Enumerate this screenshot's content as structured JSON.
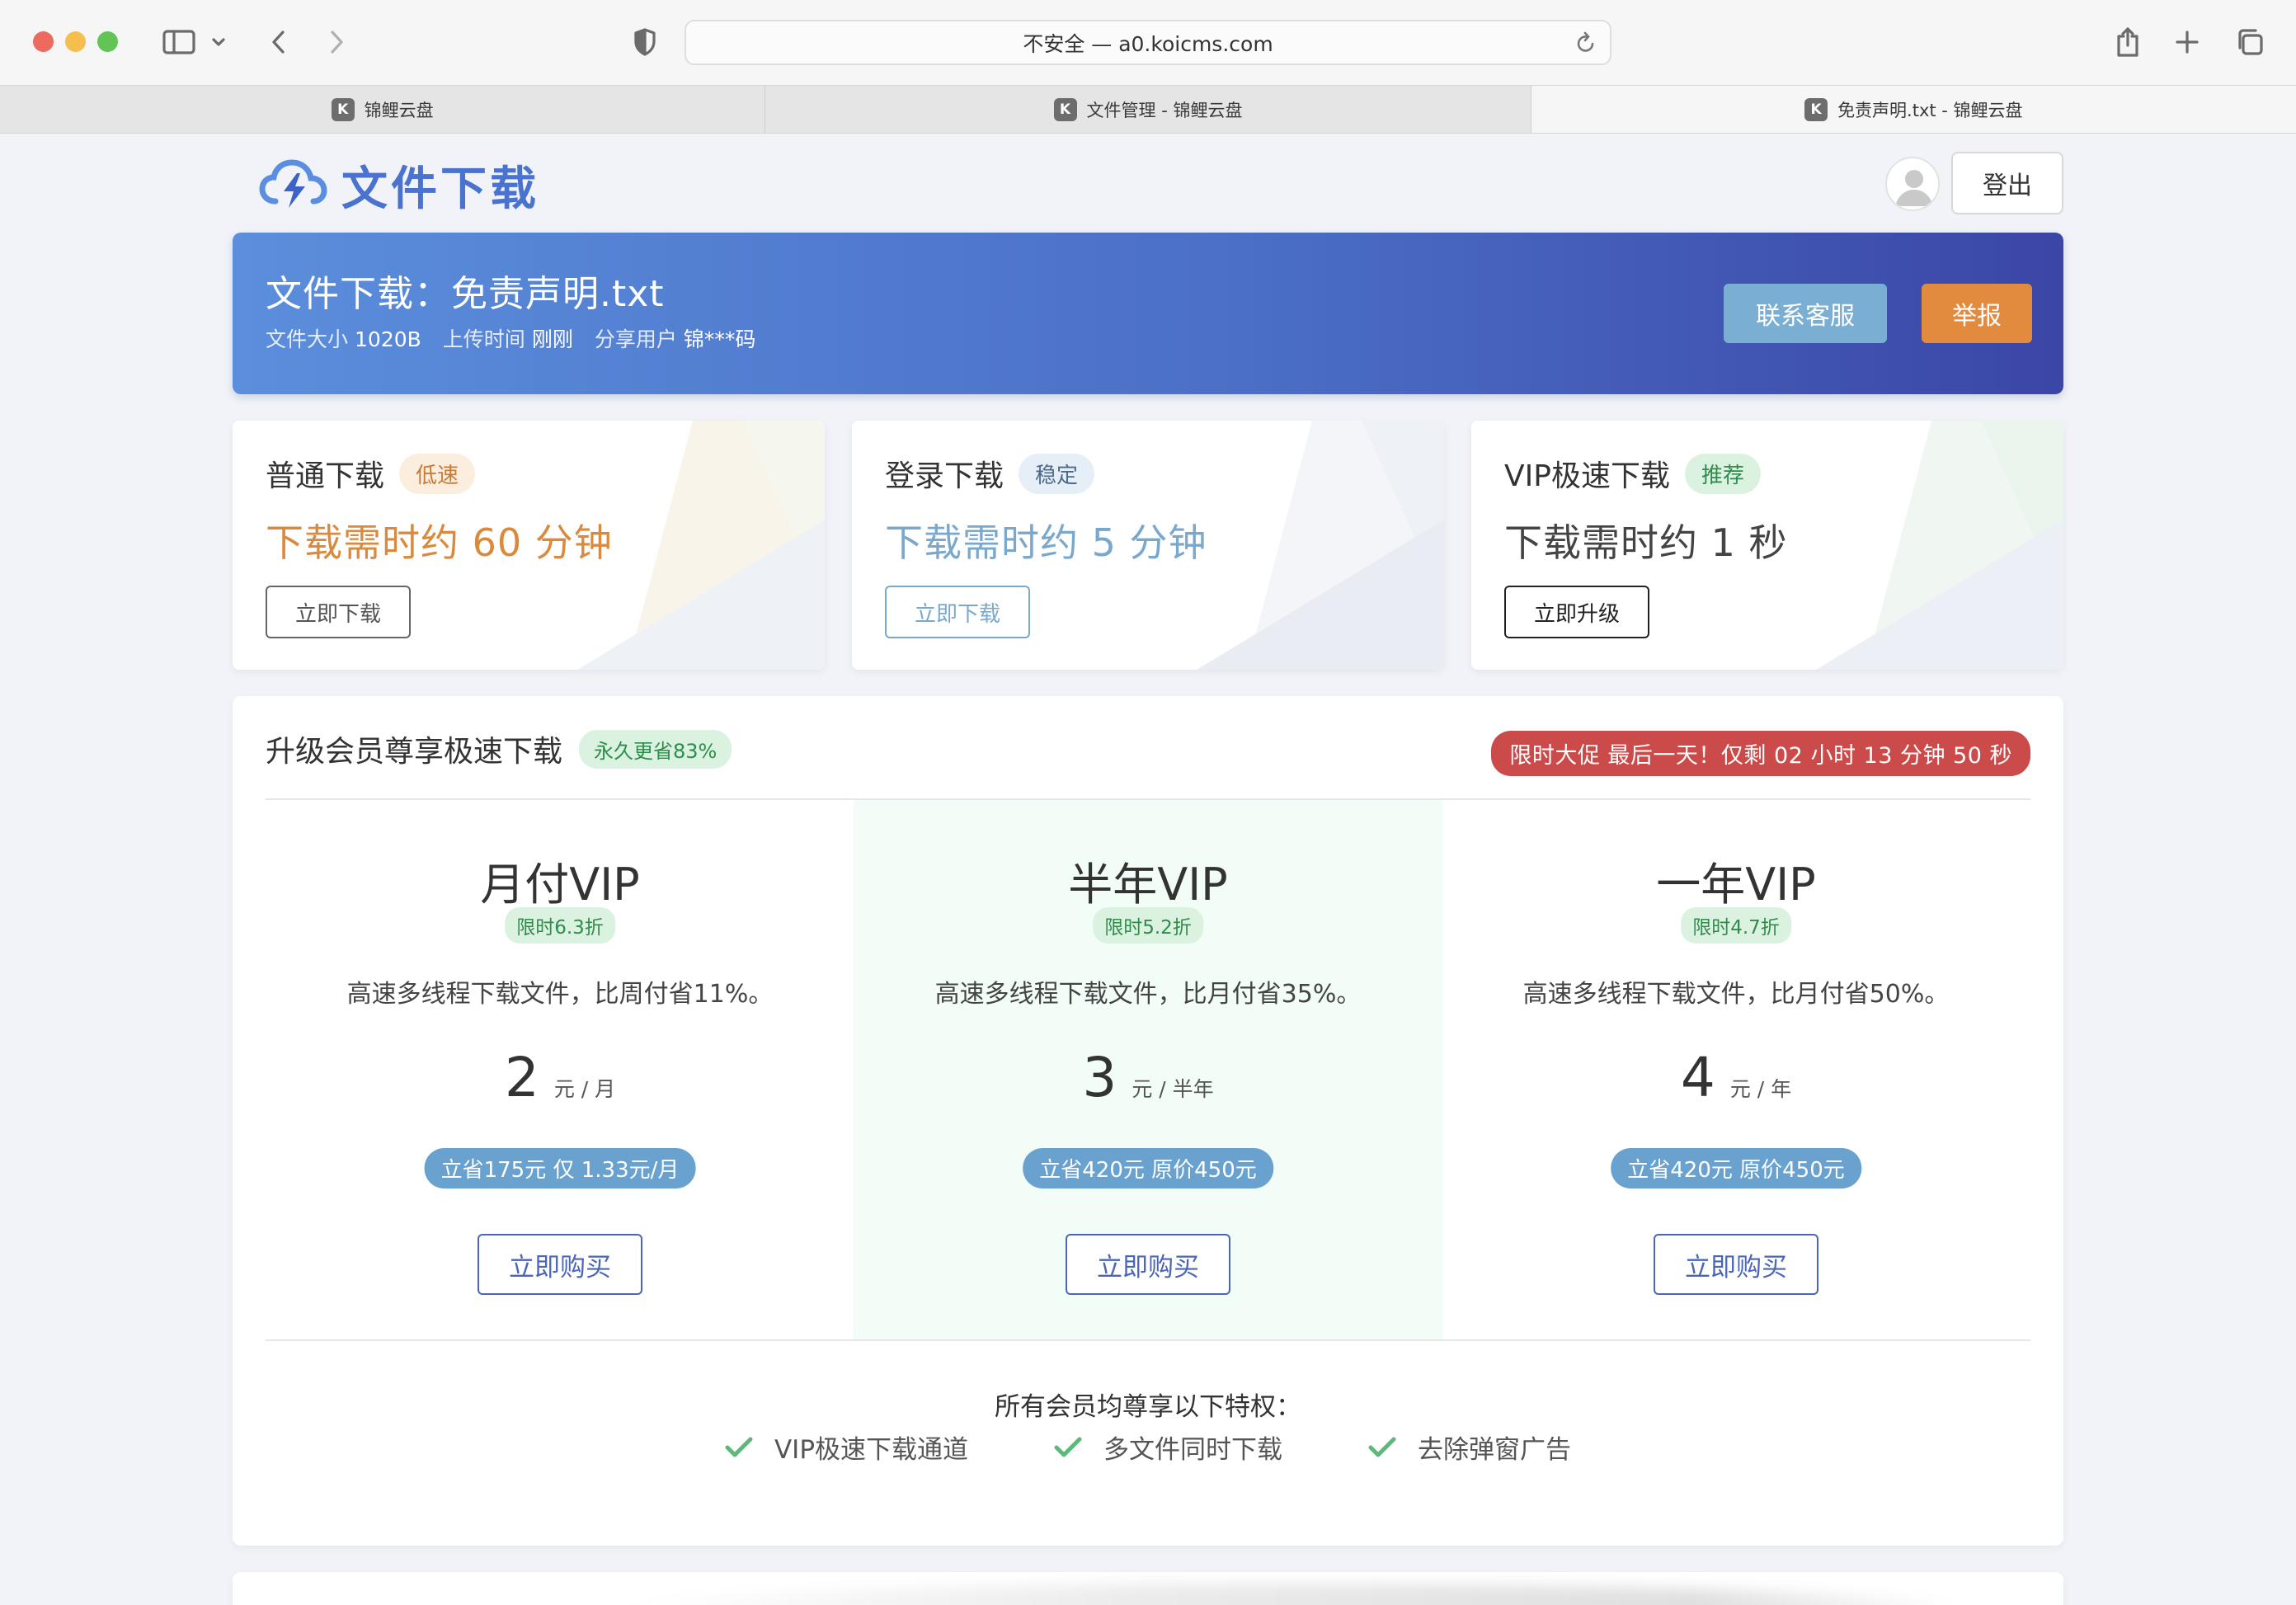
{
  "browser": {
    "address": "不安全 — a0.koicms.com",
    "tabs": [
      {
        "favicon": "K",
        "label": "锦鲤云盘"
      },
      {
        "favicon": "K",
        "label": "文件管理 - 锦鲤云盘"
      },
      {
        "favicon": "K",
        "label": "免责声明.txt - 锦鲤云盘"
      }
    ]
  },
  "header": {
    "logo_text": "文件下载",
    "logout_label": "登出"
  },
  "banner": {
    "title": "文件下载：免责声明.txt",
    "size_label": "文件大小",
    "size_value": "1020B",
    "upload_label": "上传时间",
    "upload_value": "刚刚",
    "user_label": "分享用户",
    "user_value": "锦***码",
    "service_label": "联系客服",
    "report_label": "举报"
  },
  "download_options": [
    {
      "title": "普通下载",
      "badge": "低速",
      "desc": "下载需时约 60 分钟",
      "button": "立即下载"
    },
    {
      "title": "登录下载",
      "badge": "稳定",
      "desc": "下载需时约 5 分钟",
      "button": "立即下载"
    },
    {
      "title": "VIP极速下载",
      "badge": "推荐",
      "desc": "下载需时约 1 秒",
      "button": "立即升级"
    }
  ],
  "vip": {
    "title": "升级会员尊享极速下载",
    "save_badge": "永久更省83%",
    "promo": "限时大促 最后一天！仅剩 02 小时 13 分钟 50 秒",
    "plans": [
      {
        "name": "月付VIP",
        "tag": "限时6.3折",
        "desc": "高速多线程下载文件，比周付省11%。",
        "price": "2",
        "unit": "元 / 月",
        "save": "立省175元 仅 1.33元/月",
        "button": "立即购买"
      },
      {
        "name": "半年VIP",
        "tag": "限时5.2折",
        "desc": "高速多线程下载文件，比月付省35%。",
        "price": "3",
        "unit": "元 / 半年",
        "save": "立省420元 原价450元",
        "button": "立即购买"
      },
      {
        "name": "一年VIP",
        "tag": "限时4.7折",
        "desc": "高速多线程下载文件，比月付省50%。",
        "price": "4",
        "unit": "元 / 年",
        "save": "立省420元 原价450元",
        "button": "立即购买"
      }
    ],
    "perks_title": "所有会员均尊享以下特权：",
    "perks": [
      "VIP极速下载通道",
      "多文件同时下载",
      "去除弹窗广告"
    ]
  },
  "colors": {
    "accent_blue": "#4a72cf",
    "orange": "#e28a3e",
    "slow_text": "#d98a3e",
    "login_text": "#7aa8cc",
    "promo_red": "#cb4a4a",
    "green_check": "#5cb97a"
  }
}
